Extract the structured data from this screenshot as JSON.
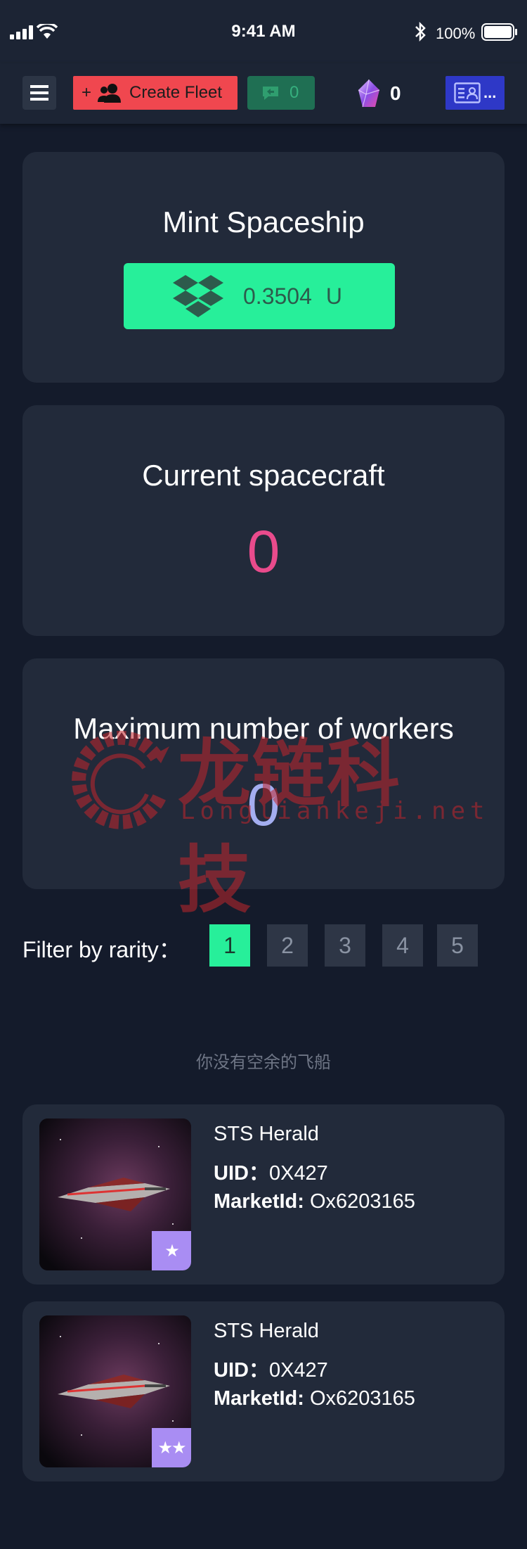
{
  "status_bar": {
    "time": "9:41 AM",
    "battery": "100%"
  },
  "nav": {
    "menu_icon": "hamburger-icon",
    "create_fleet_plus": "+",
    "create_fleet_label": "Create Fleet",
    "message_count": "0",
    "gem_count": "0",
    "profile_suffix": "..."
  },
  "mint": {
    "title": "Mint Spaceship",
    "price": "0.3504",
    "unit": "U",
    "icon": "dropbox-box-icon"
  },
  "current": {
    "title": "Current spacecraft",
    "value": "0"
  },
  "workers": {
    "title": "Maximum number of workers",
    "value": "0"
  },
  "watermark": {
    "cn": "龙链科技",
    "en": "Longliankeji.net"
  },
  "filter": {
    "label": "Filter by rarity：",
    "options": [
      "1",
      "2",
      "3",
      "4",
      "5"
    ],
    "selected": "1"
  },
  "empty_message": "你没有空余的飞船",
  "ships": [
    {
      "name": "STS Herald",
      "uid_label": "UID：",
      "uid": "0X427",
      "market_label": "MarketId:",
      "market_id": "Ox6203165",
      "stars": "★"
    },
    {
      "name": "STS Herald",
      "uid_label": "UID：",
      "uid": "0X427",
      "market_label": "MarketId:",
      "market_id": "Ox6203165",
      "stars": "★★"
    }
  ],
  "colors": {
    "background": "#141b2b",
    "card": "#222a3a",
    "accent_green": "#27ef9a",
    "accent_red": "#f0474f",
    "accent_pink": "#e94b8c",
    "accent_blue": "#2e38c7",
    "badge_purple": "#a98df3"
  }
}
